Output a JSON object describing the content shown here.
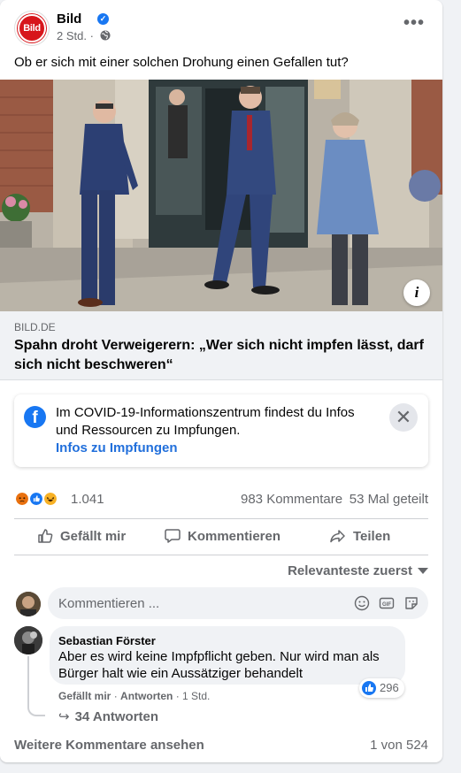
{
  "post": {
    "page_name": "Bild",
    "logo_text": "Bild",
    "time": "2 Std.",
    "text": "Ob er sich mit einer solchen Drohung einen Gefallen tut?",
    "more_label": "•••",
    "info_label": "i"
  },
  "link_preview": {
    "domain": "BILD.DE",
    "title": "Spahn droht Verweigerern: „Wer sich nicht impfen lässt, darf sich nicht beschweren“"
  },
  "covid_box": {
    "text": "Im COVID-19-Informationszentrum findest du Infos und Ressourcen zu Impfungen.",
    "link": "Infos zu Impfungen",
    "close": "✕"
  },
  "stats": {
    "reactions": "1.041",
    "comments": "983 Kommentare",
    "shares": "53 Mal geteilt"
  },
  "actions": {
    "like": "Gefällt mir",
    "comment": "Kommentieren",
    "share": "Teilen"
  },
  "sort_label": "Relevanteste zuerst",
  "composer": {
    "placeholder": "Kommentieren ..."
  },
  "comment": {
    "author": "Sebastian Förster",
    "text": "Aber es wird keine Impfpflicht geben. Nur wird man als Bürger halt wie ein Aussätziger behandelt",
    "likes": "296",
    "like_action": "Gefällt mir",
    "reply_action": "Antworten",
    "time": "1 Std.",
    "replies": "34 Antworten"
  },
  "footer": {
    "more_comments": "Weitere Kommentare ansehen",
    "pager": "1 von 524"
  },
  "colors": {
    "accent": "#1877f2",
    "link": "#216fdb",
    "brand_red": "#d7161b",
    "secondary_text": "#65676b"
  }
}
